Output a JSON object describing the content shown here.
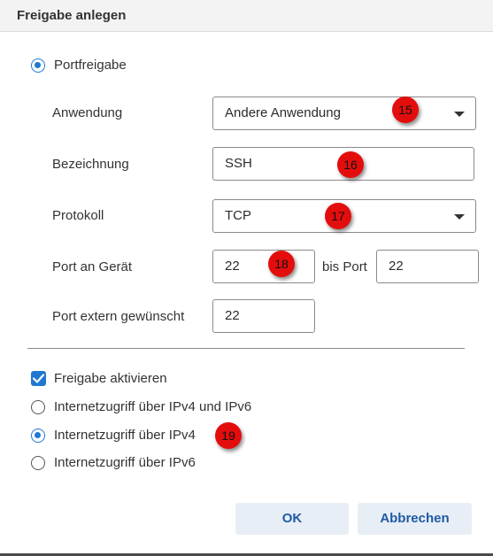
{
  "dialog": {
    "title": "Freigabe anlegen"
  },
  "port_section": {
    "radio_label": "Portfreigabe",
    "anwendung": {
      "label": "Anwendung",
      "value": "Andere Anwendung"
    },
    "bezeichnung": {
      "label": "Bezeichnung",
      "value": "SSH"
    },
    "protokoll": {
      "label": "Protokoll",
      "value": "TCP"
    },
    "port_geraet": {
      "label": "Port an Gerät",
      "value": "22"
    },
    "bis_port": {
      "label": "bis Port",
      "value": "22"
    },
    "port_extern": {
      "label": "Port extern gewünscht",
      "value": "22"
    }
  },
  "options": {
    "aktivieren": {
      "label": "Freigabe aktivieren",
      "checked": true
    },
    "ipv4_ipv6": {
      "label": "Internetzugriff über IPv4 und IPv6",
      "checked": false
    },
    "ipv4": {
      "label": "Internetzugriff über IPv4",
      "checked": true
    },
    "ipv6": {
      "label": "Internetzugriff über IPv6",
      "checked": false
    }
  },
  "badges": [
    "15",
    "16",
    "17",
    "18",
    "19"
  ],
  "buttons": {
    "ok": "OK",
    "cancel": "Abbrechen"
  },
  "colors": {
    "accent": "#1f78d1",
    "badge": "#e40d0d",
    "button_bg": "#e8eef5"
  }
}
